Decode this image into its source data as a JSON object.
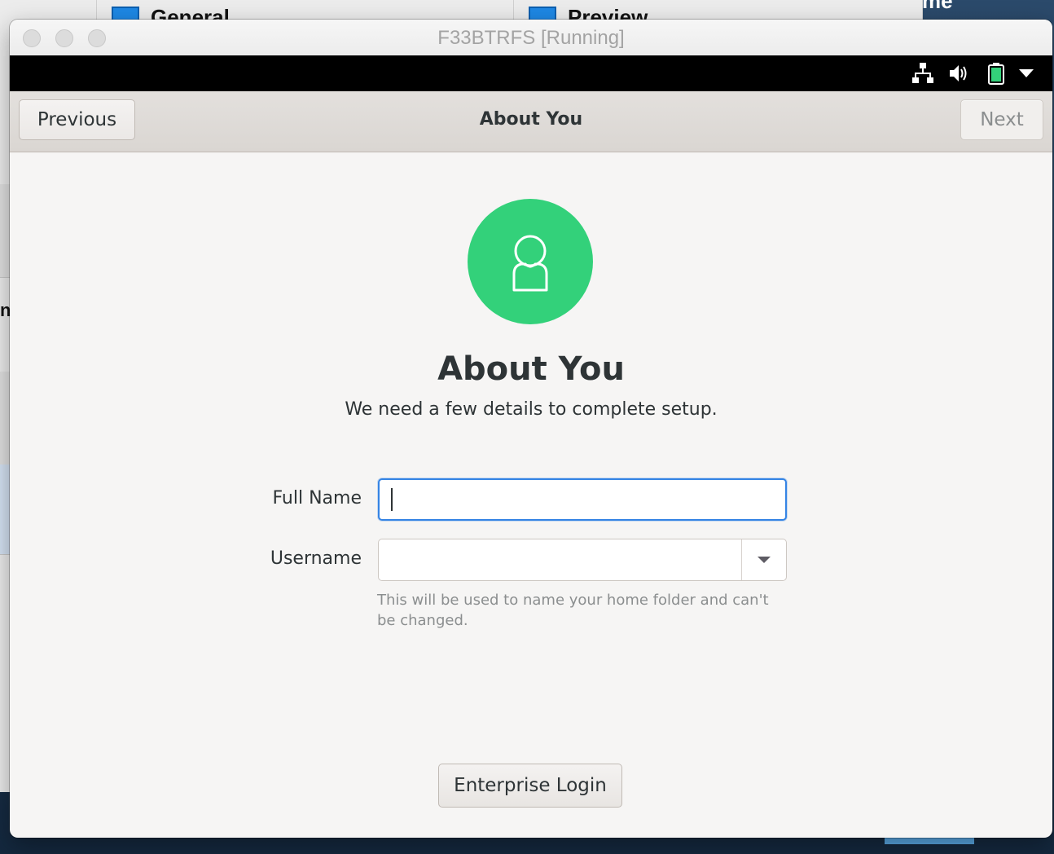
{
  "background": {
    "tab_left": "General",
    "tab_right": "Preview",
    "left_fragment": "n",
    "right_fragment": "me"
  },
  "window": {
    "title": "F33BTRFS [Running]"
  },
  "tray": {
    "icons": [
      "network-icon",
      "volume-icon",
      "battery-icon",
      "menu-arrow-icon"
    ]
  },
  "headerbar": {
    "previous_label": "Previous",
    "title": "About You",
    "next_label": "Next"
  },
  "main": {
    "avatar_icon": "user-avatar-icon",
    "avatar_color": "#33d17a",
    "heading": "About You",
    "subheading": "We need a few details to complete setup.",
    "full_name_label": "Full Name",
    "full_name_value": "",
    "username_label": "Username",
    "username_value": "",
    "username_hint": "This will be used to name your home folder and can't be changed.",
    "enterprise_login_label": "Enterprise Login"
  },
  "colors": {
    "accent": "#3584e4",
    "avatar": "#33d17a"
  }
}
